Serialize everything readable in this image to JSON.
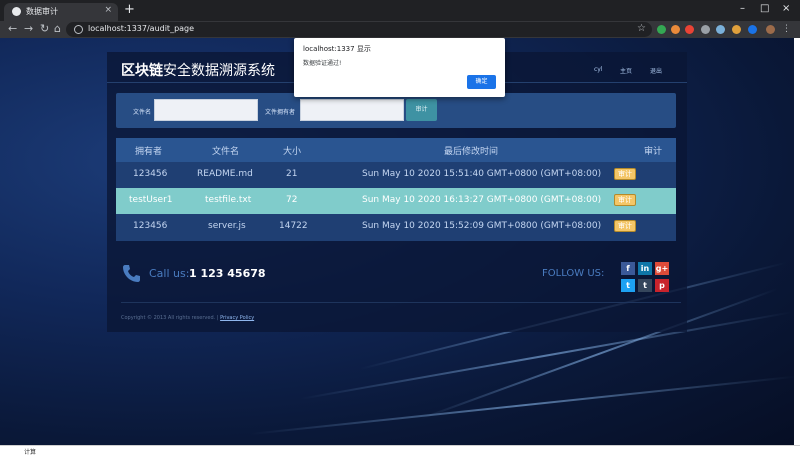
{
  "browser": {
    "tab_title": "数据审计",
    "tab_close": "×",
    "new_tab": "+",
    "url": "localhost:1337/audit_page",
    "window_controls": {
      "minimize": "–",
      "maximize": "□",
      "close": "×"
    },
    "nav": {
      "back": "←",
      "forward": "→",
      "reload": "↻",
      "home": "⌂"
    },
    "star": "☆"
  },
  "header": {
    "title_bold": "区块链",
    "title_rest": "安全数据溯源系统",
    "nav_user": "cyl",
    "nav_home": "主页",
    "nav_logout": "退出"
  },
  "search": {
    "filename_label": "文件名",
    "owner_label": "文件拥有者",
    "filename_value": "",
    "owner_value": "",
    "audit_button": "审计"
  },
  "table": {
    "columns": [
      "拥有者",
      "文件名",
      "大小",
      "最后修改时间",
      "审计"
    ],
    "rows": [
      {
        "owner": "123456",
        "filename": "README.md",
        "size": "21",
        "modified": "Sun May 10 2020 15:51:40 GMT+0800 (GMT+08:00)",
        "audit": "审计"
      },
      {
        "owner": "testUser1",
        "filename": "testfile.txt",
        "size": "72",
        "modified": "Sun May 10 2020 16:13:27 GMT+0800 (GMT+08:00)",
        "audit": "审计"
      },
      {
        "owner": "123456",
        "filename": "server.js",
        "size": "14722",
        "modified": "Sun May 10 2020 15:52:09 GMT+0800 (GMT+08:00)",
        "audit": "审计"
      }
    ],
    "highlight_color": "#80cccb"
  },
  "footer": {
    "call_label": "Call us:",
    "call_number": "1 123 45678",
    "follow_label": "FOLLOW US:",
    "social": [
      "f",
      "in",
      "g+",
      "t",
      "t",
      "p"
    ],
    "copyright": "Copyright © 2013 All rights reserved.",
    "privacy": "Privacy Policy"
  },
  "dialog": {
    "title": "localhost:1337 显示",
    "message": "数据验证通过!",
    "ok": "确定"
  },
  "taskbar": {
    "left_label": "计算"
  }
}
